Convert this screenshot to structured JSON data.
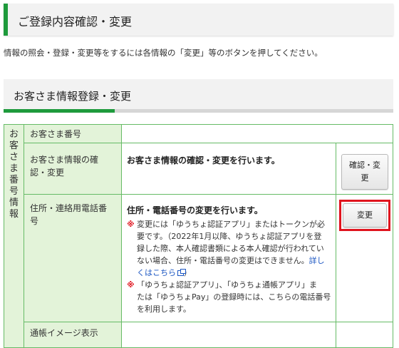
{
  "page_title": "ご登録内容確認・変更",
  "intro_text": "情報の照会・登録・変更等をするには各情報の「変更」等のボタンを押してください。",
  "section_title": "お客さま情報登録・変更",
  "side_label": [
    "お",
    "客",
    "さ",
    "ま",
    "番",
    "号",
    "情",
    "報"
  ],
  "rows": {
    "customer_number": {
      "label": "お客さま番号"
    },
    "customer_info": {
      "label_line1": "お客さま情報の確",
      "label_line2": "認・変更",
      "description": "お客さま情報の確認・変更を行います。",
      "button_line1": "確認・変",
      "button_line2": "更"
    },
    "address_phone": {
      "label_line1": "住所・連絡用電話番",
      "label_line2": "号",
      "description": "住所・電話番号の変更を行います。",
      "note_mark": "※",
      "note1_lines": [
        "変更には「ゆうちょ認証アプリ」またはトークンが必",
        "要です。（2022年1月以降、ゆうちょ認証アプリを登",
        "録した際、本人確認書類による本人確認が行われてい",
        "ない場合、住所・電話番号の変更はできません。"
      ],
      "note1_link_a": "詳し",
      "note1_link_b": "くはこちら",
      "note1_close": "）",
      "note2_lines": [
        "「ゆうちょ認証アプリ」、「ゆうちょ通帳アプリ」ま",
        "たは「ゆうちょPay」の登録時には、こちらの電話番号",
        "を利用します。"
      ],
      "button_label": "変更"
    },
    "passbook_image": {
      "label": "通帳イメージ表示"
    }
  },
  "colors": {
    "accent_green": "#1e9a3c",
    "table_fill": "#e3f3d9",
    "highlight_red": "#e0141e",
    "link_blue": "#1a55c2"
  }
}
